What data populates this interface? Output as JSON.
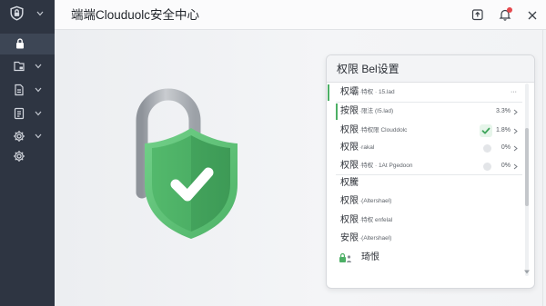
{
  "app": {
    "title": "端端Clouduolc安全中心"
  },
  "header": {
    "icons": [
      "export-icon",
      "bell-icon",
      "close-icon"
    ],
    "bell_has_badge": true
  },
  "sidebar": {
    "items": [
      {
        "icon": "shield-lock-icon",
        "has_chevron": true
      },
      {
        "icon": "lock-icon",
        "selected": true
      },
      {
        "icon": "folder-icon",
        "has_chevron": true
      },
      {
        "icon": "document-icon",
        "has_chevron": true
      },
      {
        "icon": "file-icon",
        "has_chevron": true
      },
      {
        "icon": "gear-icon",
        "has_chevron": true
      },
      {
        "icon": "gear-icon"
      }
    ]
  },
  "hero": {
    "icon": "padlock-shield-check-icon"
  },
  "panel": {
    "title": "权限 Bel设置",
    "rows": [
      {
        "label": "权壩",
        "detail": "·特权 · 15.lad",
        "value": "···",
        "accent": true
      },
      {
        "label": "按限",
        "detail": "·限法 (I5.lad)",
        "value": "3.3%",
        "accent": true,
        "chevron": true
      },
      {
        "label": "权限",
        "detail": "·特权限 Clouddolc",
        "value": "1.8%",
        "status": "check-icon",
        "chevron": true
      },
      {
        "label": "权限",
        "detail": "·rakal",
        "value": "0%",
        "status": "dot-icon",
        "chevron": true
      },
      {
        "label": "权限",
        "detail": "·特权 · 1At Pgedoon",
        "value": "0%",
        "status": "dot-icon",
        "chevron": true
      },
      {
        "label": "权騰"
      },
      {
        "label": "权限",
        "detail": "·(Altershael)"
      },
      {
        "label": "权限",
        "detail": "·特权 enfelal"
      },
      {
        "label": "安限",
        "detail": "·(Altershael)"
      },
      {
        "label": "琦恨",
        "icon": "user-lock-icon"
      }
    ]
  },
  "colors": {
    "sidebar": "#2e3542",
    "sidebar_selected": "#3d4655",
    "accent": "#4caf65",
    "badge": "#e5484d"
  }
}
